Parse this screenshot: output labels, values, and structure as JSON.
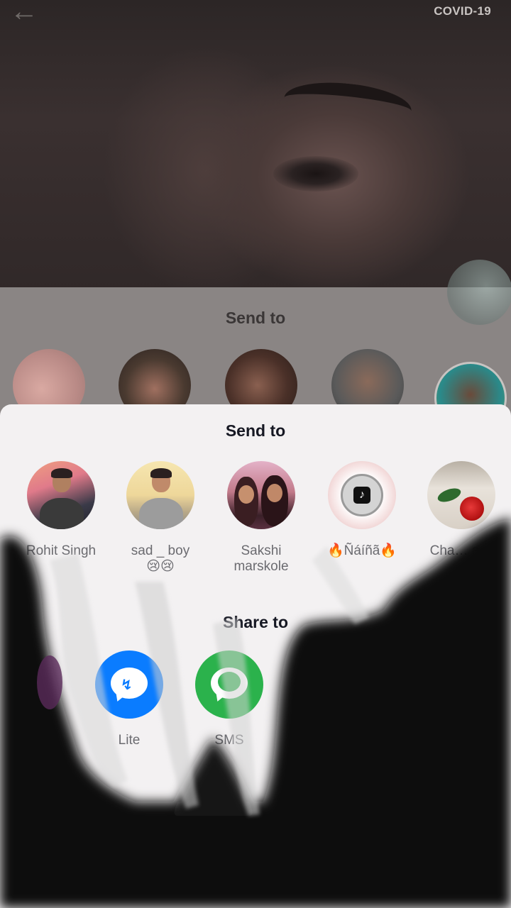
{
  "top_bar": {
    "back_icon": "arrow-left-icon",
    "covid_label": "COVID-19"
  },
  "background_sheet": {
    "title": "Send to"
  },
  "share_sheet": {
    "send_to_title": "Send to",
    "contacts": [
      {
        "name": "Rohit Singh"
      },
      {
        "name": "sad _ boy\n😢😢"
      },
      {
        "name": "Sakshi marskole"
      },
      {
        "name": "🔥Ñáíñã🔥"
      },
      {
        "name": "Cha… a…"
      }
    ],
    "share_to_title": "Share to",
    "share_targets": [
      {
        "label": "Lite",
        "icon": "messenger-lite-icon",
        "color": "#0a7cff"
      },
      {
        "label": "SMS",
        "icon": "sms-icon",
        "color": "#2bb24c"
      }
    ]
  }
}
